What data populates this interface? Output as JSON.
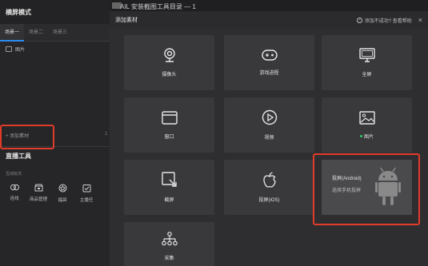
{
  "left_panel": {
    "title": "横屏模式",
    "scenes": [
      "场景一",
      "场景二",
      "场景三"
    ],
    "source_item": "图片",
    "add_source": "+ 添加素材",
    "live_tools_title": "直播工具",
    "interact_label": "互动玩法",
    "tools": [
      {
        "label": "连线",
        "icon": "link-icon"
      },
      {
        "label": "商品管理",
        "icon": "shop-icon"
      },
      {
        "label": "福袋",
        "icon": "gift-badge-icon"
      },
      {
        "label": "主播任",
        "icon": "task-check-icon"
      }
    ],
    "edge_marker": "1"
  },
  "top_strip": {
    "title": "AIL 安装截图工具目录 — 1"
  },
  "modal": {
    "title": "添加素材",
    "help": "添加不成功? 查看帮助",
    "close": "×",
    "tiles": [
      {
        "label": "摄像头",
        "icon": "camera-icon"
      },
      {
        "label": "游戏进程",
        "icon": "gamepad-icon"
      },
      {
        "label": "全屏",
        "icon": "monitor-icon"
      },
      {
        "label": "窗口",
        "icon": "window-icon"
      },
      {
        "label": "视频",
        "icon": "play-icon"
      },
      {
        "label": "图片",
        "icon": "image-icon"
      },
      {
        "label": "截屏",
        "icon": "screenshot-icon"
      },
      {
        "label": "投屏(iOS)",
        "icon": "apple-icon"
      },
      {
        "label": "投屏(Android)",
        "subtitle": "选择手机投屏",
        "icon": "android-icon"
      },
      {
        "label": "采集",
        "icon": "capture-icon"
      }
    ]
  },
  "colors": {
    "highlight": "#e23b2a",
    "accent": "#2d8cf0",
    "new_dot": "#2ecc71"
  }
}
